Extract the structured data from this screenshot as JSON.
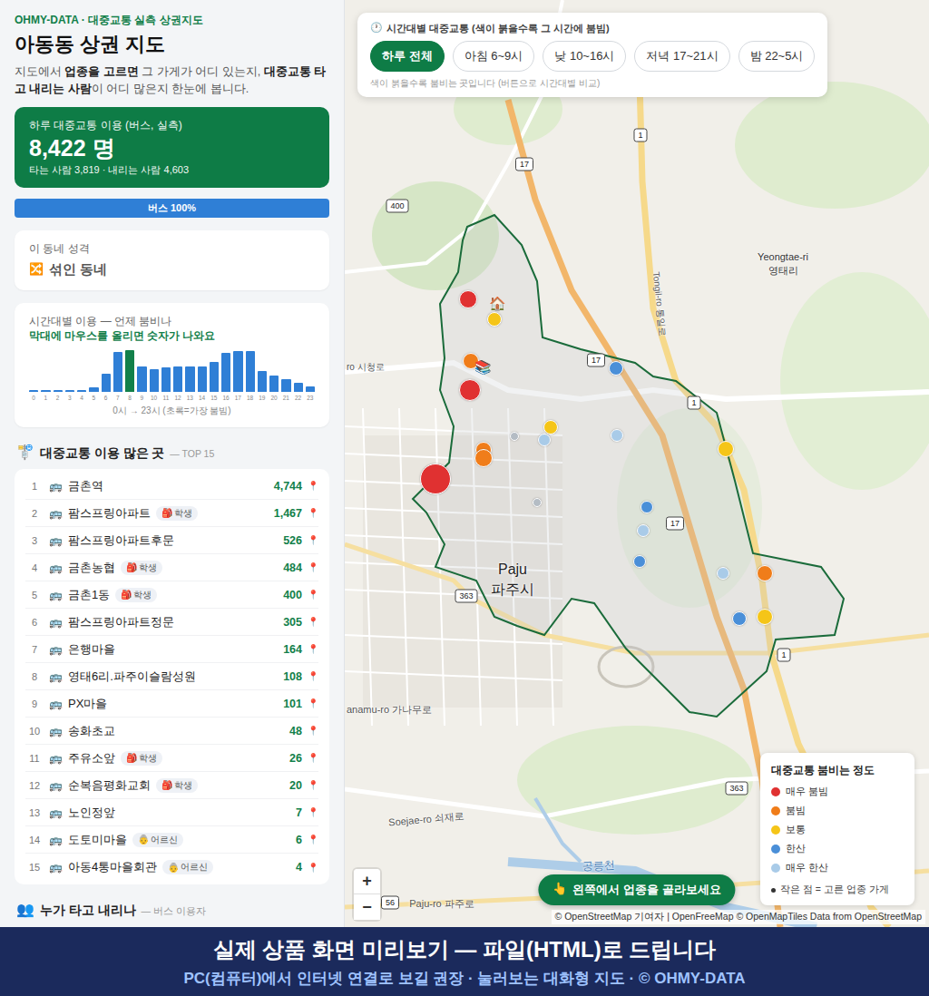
{
  "brand": "OHMY-DATA · 대중교통 실측 상권지도",
  "title": "아동동 상권 지도",
  "description": [
    {
      "text": "지도에서 ",
      "bold": false
    },
    {
      "text": "업종을 고르면",
      "bold": true
    },
    {
      "text": " 그 가게가 어디 있는지, ",
      "bold": false
    },
    {
      "text": "대중교통 타고 내리는 사람",
      "bold": true
    },
    {
      "text": "이 어디 많은지 한눈에 봅니다.",
      "bold": false
    }
  ],
  "summary": {
    "label": "하루 대중교통 이용 (버스, 실측)",
    "value": "8,422",
    "unit": "명",
    "detail": "타는 사람 3,819 · 내리는 사람 4,603"
  },
  "mode_bar": [
    {
      "label": "버스 100%",
      "level": 1,
      "color": "#2f7fd6"
    }
  ],
  "character": {
    "label": "이 동네 성격",
    "icon": "🔀",
    "value": "섞인 동네"
  },
  "hourly_chart": {
    "title": "시간대별 이용 — 언제 붐비나",
    "hint": "막대에 마우스를 올리면 숫자가 나와요",
    "values": [
      30,
      25,
      20,
      20,
      30,
      85,
      325,
      700,
      735,
      455,
      405,
      425,
      440,
      440,
      455,
      520,
      685,
      720,
      715,
      360,
      295,
      230,
      165,
      100
    ],
    "x_ticks": [
      "0",
      "1",
      "2",
      "3",
      "4",
      "5",
      "6",
      "7",
      "8",
      "9",
      "10",
      "11",
      "12",
      "13",
      "14",
      "15",
      "16",
      "17",
      "18",
      "19",
      "20",
      "21",
      "22",
      "23"
    ],
    "caption": "0시 → 23시 (초록=가장 붐빔)"
  },
  "top_list": {
    "icon": "🚏",
    "title": "대중교통 이용 많은 곳",
    "subtitle": "— TOP 15",
    "rows": [
      {
        "rank": "1",
        "icon": "🚌",
        "name": "금촌역",
        "tag": null,
        "count": "4,744",
        "pin": "📍"
      },
      {
        "rank": "2",
        "icon": "🚌",
        "name": "팜스프링아파트",
        "tag": {
          "icon": "🎒",
          "label": "학생"
        },
        "count": "1,467",
        "pin": "📍"
      },
      {
        "rank": "3",
        "icon": "🚌",
        "name": "팜스프링아파트후문",
        "tag": null,
        "count": "526",
        "pin": "📍"
      },
      {
        "rank": "4",
        "icon": "🚌",
        "name": "금촌농협",
        "tag": {
          "icon": "🎒",
          "label": "학생"
        },
        "count": "484",
        "pin": "📍"
      },
      {
        "rank": "5",
        "icon": "🚌",
        "name": "금촌1동",
        "tag": {
          "icon": "🎒",
          "label": "학생"
        },
        "count": "400",
        "pin": "📍"
      },
      {
        "rank": "6",
        "icon": "🚌",
        "name": "팜스프링아파트정문",
        "tag": null,
        "count": "305",
        "pin": "📍"
      },
      {
        "rank": "7",
        "icon": "🚌",
        "name": "은행마을",
        "tag": null,
        "count": "164",
        "pin": "📍"
      },
      {
        "rank": "8",
        "icon": "🚌",
        "name": "영태6리.파주이슬람성원",
        "tag": null,
        "count": "108",
        "pin": "📍"
      },
      {
        "rank": "9",
        "icon": "🚌",
        "name": "PX마을",
        "tag": null,
        "count": "101",
        "pin": "📍"
      },
      {
        "rank": "10",
        "icon": "🚌",
        "name": "송화초교",
        "tag": null,
        "count": "48",
        "pin": "📍"
      },
      {
        "rank": "11",
        "icon": "🚌",
        "name": "주유소앞",
        "tag": {
          "icon": "🎒",
          "label": "학생"
        },
        "count": "26",
        "pin": "📍"
      },
      {
        "rank": "12",
        "icon": "🚌",
        "name": "순복음평화교회",
        "tag": {
          "icon": "🎒",
          "label": "학생"
        },
        "count": "20",
        "pin": "📍"
      },
      {
        "rank": "13",
        "icon": "🚌",
        "name": "노인정앞",
        "tag": null,
        "count": "7",
        "pin": "📍"
      },
      {
        "rank": "14",
        "icon": "🚌",
        "name": "도토미마을",
        "tag": {
          "icon": "👵",
          "label": "어르신"
        },
        "count": "6",
        "pin": "📍"
      },
      {
        "rank": "15",
        "icon": "🚌",
        "name": "아동4통마을회관",
        "tag": {
          "icon": "👵",
          "label": "어르신"
        },
        "count": "4",
        "pin": "📍"
      }
    ]
  },
  "riders": {
    "icon": "👥",
    "title": "누가 타고 내리나",
    "subtitle": "— 버스 이용자"
  },
  "time_filter": {
    "icon": "🕐",
    "title": "시간대별 대중교통 (색이 붉을수록 그 시간에 붐빔)",
    "buttons": [
      {
        "label": "하루 전체",
        "selected": true
      },
      {
        "label": "아침 6~9시",
        "selected": false
      },
      {
        "label": "낮 10~16시",
        "selected": false
      },
      {
        "label": "저녁 17~21시",
        "selected": false
      },
      {
        "label": "밤 22~5시",
        "selected": false
      }
    ],
    "hint": "색이 붉을수록 붐비는 곳입니다 (버튼으로 시간대별 비교)"
  },
  "map": {
    "labels": [
      "Yeongtae-ri",
      "영태리",
      "Paju",
      "파주시",
      "Tongil-ro 통일로",
      "ro 시청로",
      "anamu-ro 가나무로",
      "Soejae-ro 쇠재로",
      "공릉천",
      "Paju-ro 파주로"
    ],
    "shields": [
      "1",
      "17",
      "400",
      "17",
      "1",
      "17",
      "363",
      "1",
      "363",
      "56"
    ],
    "markers": [
      {
        "color": "#e03131"
      },
      {
        "color": "#f5c518"
      },
      {
        "color": "#f07d1a"
      },
      {
        "color": "#e03131"
      },
      {
        "color": "#f07d1a"
      },
      {
        "color": "#f07d1a"
      },
      {
        "color": "#e03131"
      },
      {
        "color": "#f5c518"
      },
      {
        "color": "#b4bcc4"
      },
      {
        "color": "#a9cbe8"
      },
      {
        "color": "#4a8fd8"
      },
      {
        "color": "#a9cbe8"
      },
      {
        "color": "#b4bcc4"
      },
      {
        "color": "#4a8fd8"
      },
      {
        "color": "#a9cbe8"
      },
      {
        "color": "#4a8fd8"
      },
      {
        "color": "#a9cbe8"
      },
      {
        "color": "#f07d1a"
      },
      {
        "color": "#f5c518"
      },
      {
        "color": "#4a8fd8"
      },
      {
        "color": "#f5c518"
      }
    ],
    "place_icons": [
      "🏠",
      "📚"
    ],
    "zoom_in": "+",
    "zoom_out": "−",
    "cta": {
      "icon": "👆",
      "label": "왼쪽에서 업종을 골라보세요"
    },
    "attribution": "© OpenStreetMap 기여자 | OpenFreeMap © OpenMapTiles Data from OpenStreetMap"
  },
  "legend": {
    "title": "대중교통 붐비는 정도",
    "items": [
      {
        "label": "매우 붐빔",
        "color": "#e03131"
      },
      {
        "label": "붐빔",
        "color": "#f07d1a"
      },
      {
        "label": "보통",
        "color": "#f5c518"
      },
      {
        "label": "한산",
        "color": "#4a8fd8"
      },
      {
        "label": "매우 한산",
        "color": "#a9cbe8"
      }
    ],
    "note": "작은 점 = 고른 업종 가게"
  },
  "banner": {
    "title": "실제 상품 화면 미리보기 — 파일(HTML)로 드립니다",
    "subtitle": "PC(컴퓨터)에서 인터넷 연결로 보길 권장 · 눌러보는 대화형 지도 · © OHMY-DATA"
  }
}
